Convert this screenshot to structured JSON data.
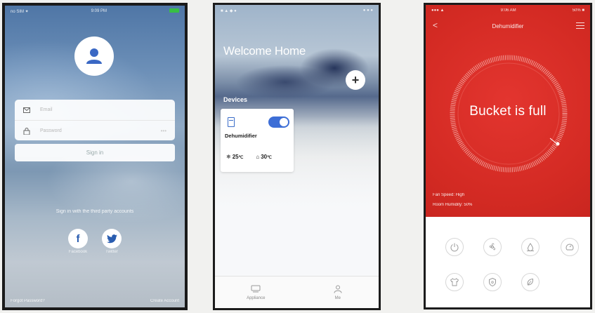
{
  "login": {
    "status": {
      "carrier": "no SIM ✦",
      "time": "9:09 PM",
      "battery": "✱ ●"
    },
    "email_placeholder": "Email",
    "password_placeholder": "Password",
    "password_toggle": "•••",
    "signin_label": "Sign in",
    "third_party_text": "Sign in with the third party accounts",
    "facebook_letter": "f",
    "facebook_label": "Facebook",
    "twitter_label": "Twitter",
    "forgot_label": "Forgot Password?",
    "create_label": "Create Account"
  },
  "home": {
    "status": {
      "left": "■ ▲ ◆ ●",
      "right": "● ● ●"
    },
    "welcome": "Welcome Home",
    "add_symbol": "+",
    "devices_label": "Devices",
    "device": {
      "name": "Dehumidifier",
      "on": true,
      "temp_indoor": "25",
      "temp_outdoor": "30",
      "unit": "℃"
    },
    "tabs": [
      {
        "label": "Appliance"
      },
      {
        "label": "Me"
      }
    ]
  },
  "dehumidifier": {
    "status": {
      "left": "●●● ▲",
      "time": "9:06 AM",
      "right": "50% ■"
    },
    "title": "Dehumidifier",
    "back_symbol": "<",
    "message": "Bucket is full",
    "fan_speed": "Fan Speed: High",
    "room_humidity": "Room Humidity: 50%",
    "controls": [
      {
        "icon": "power-icon"
      },
      {
        "icon": "fan-icon"
      },
      {
        "icon": "drop-icon"
      },
      {
        "icon": "timer-icon"
      },
      {
        "icon": "shirt-icon"
      },
      {
        "icon": "shield-icon"
      },
      {
        "icon": "leaf-icon"
      }
    ],
    "colors": {
      "panel": "#d32a23",
      "ring": "#f2a8a2"
    }
  }
}
